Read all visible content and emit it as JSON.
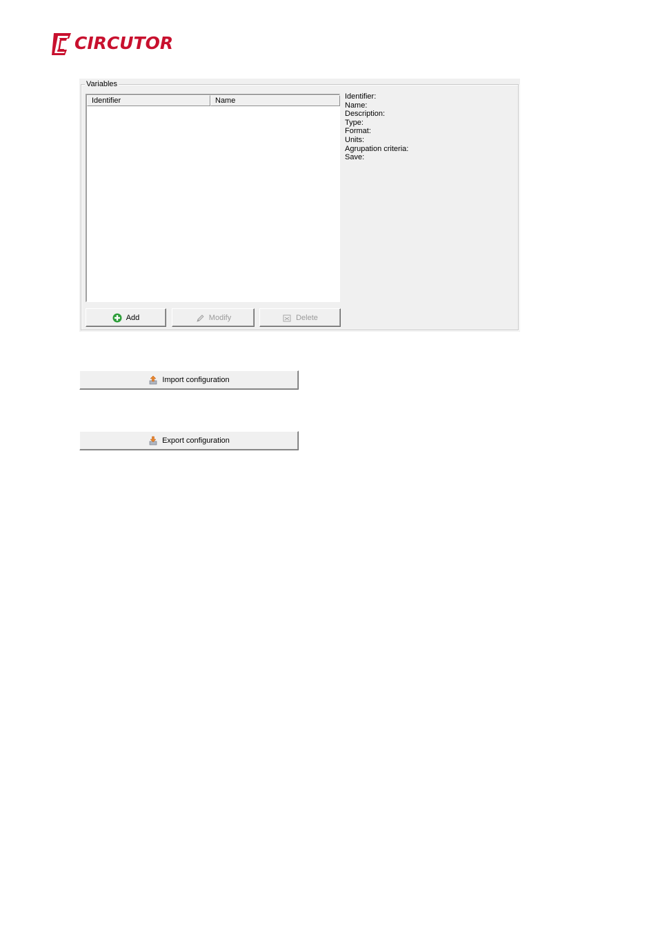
{
  "brand": {
    "name": "CIRCUTOR",
    "color": "#c8102e"
  },
  "variables_group": {
    "title": "Variables",
    "columns": [
      "Identifier",
      "Name"
    ],
    "rows": [],
    "details": [
      "Identifier:",
      "Name:",
      "Description:",
      "Type:",
      "Format:",
      "Units:",
      "Agrupation criteria:",
      "Save:"
    ],
    "buttons": {
      "add": {
        "label": "Add",
        "icon": "add-icon",
        "enabled": true
      },
      "modify": {
        "label": "Modify",
        "icon": "pencil-icon",
        "enabled": false
      },
      "delete": {
        "label": "Delete",
        "icon": "delete-icon",
        "enabled": false
      }
    }
  },
  "import_button": {
    "label": "Import configuration",
    "icon": "import-icon"
  },
  "export_button": {
    "label": "Export configuration",
    "icon": "export-icon"
  }
}
